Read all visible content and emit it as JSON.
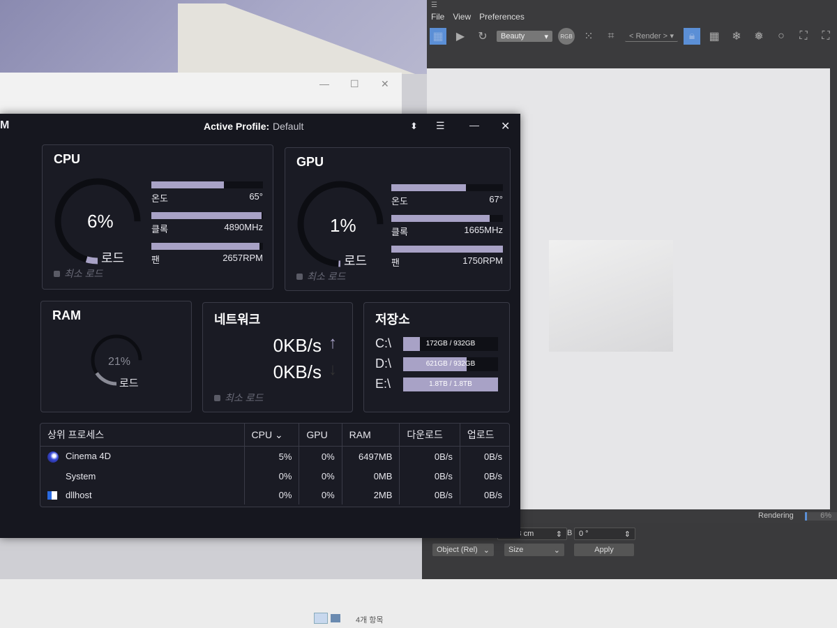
{
  "background_window": {
    "controls": [
      "—",
      "☐",
      "✕"
    ]
  },
  "c4d": {
    "menu": [
      "File",
      "View",
      "Preferences"
    ],
    "toolbar": {
      "pass_select": "Beauty",
      "rgb": "RGB",
      "region_select": "< Render >"
    },
    "status": {
      "label": "Rendering",
      "progress_text": "6%",
      "progress": 0.06
    },
    "attributes": {
      "field_size": "...833 cm",
      "field_b_label": "B",
      "field_b": "0 °",
      "mode_select": "Object (Rel)",
      "size_select": "Size",
      "apply_label": "Apply"
    },
    "accent": "#5b8fd6"
  },
  "explorer": {
    "item_count": "4개 항목"
  },
  "monitor": {
    "title_initial": "M",
    "active_profile_label": "Active Profile:",
    "active_profile_value": "Default",
    "min_load_label": "최소 로드",
    "load_label": "로드",
    "cpu": {
      "title": "CPU",
      "load": "6%",
      "load_value": 0.06,
      "stats": [
        {
          "label": "온도",
          "value": "65°",
          "fill": 0.65
        },
        {
          "label": "클록",
          "value": "4890MHz",
          "fill": 0.99
        },
        {
          "label": "팬",
          "value": "2657RPM",
          "fill": 0.97
        }
      ]
    },
    "gpu": {
      "title": "GPU",
      "load": "1%",
      "load_value": 0.01,
      "stats": [
        {
          "label": "온도",
          "value": "67°",
          "fill": 0.67
        },
        {
          "label": "클록",
          "value": "1665MHz",
          "fill": 0.88
        },
        {
          "label": "팬",
          "value": "1750RPM",
          "fill": 1.0
        }
      ]
    },
    "ram": {
      "title": "RAM",
      "load": "21%",
      "load_value": 0.21
    },
    "network": {
      "title": "네트워크",
      "up": "0KB/s",
      "down": "0KB/s"
    },
    "storage": {
      "title": "저장소",
      "drives": [
        {
          "name": "C:\\",
          "usage": "172GB / 932GB",
          "fill": 0.18
        },
        {
          "name": "D:\\",
          "usage": "621GB / 932GB",
          "fill": 0.67
        },
        {
          "name": "E:\\",
          "usage": "1.8TB / 1.8TB",
          "fill": 1.0
        }
      ]
    },
    "processes": {
      "headers": [
        "상위 프로세스",
        "CPU",
        "GPU",
        "RAM",
        "다운로드",
        "업로드"
      ],
      "rows": [
        [
          "Cinema 4D",
          "5%",
          "0%",
          "6497MB",
          "0B/s",
          "0B/s"
        ],
        [
          "System",
          "0%",
          "0%",
          "0MB",
          "0B/s",
          "0B/s"
        ],
        [
          "dllhost",
          "0%",
          "0%",
          "2MB",
          "0B/s",
          "0B/s"
        ]
      ]
    },
    "bar_color": "#a8a2c6"
  }
}
